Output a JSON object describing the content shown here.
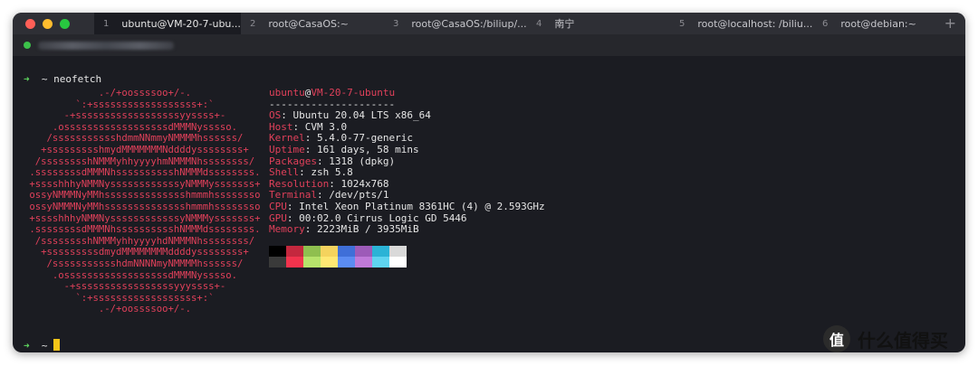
{
  "window": {
    "traffic_lights": {
      "close": "#ff5f57",
      "minimize": "#febc2e",
      "zoom": "#28c840"
    },
    "tabs": [
      {
        "num": "1",
        "title": "ubuntu@VM-20-7-ubu..."
      },
      {
        "num": "2",
        "title": "root@CasaOS:~"
      },
      {
        "num": "3",
        "title": "root@CasaOS:/biliup/..."
      },
      {
        "num": "4",
        "title": "南宁"
      },
      {
        "num": "5",
        "title": "root@localhost: /biliu..."
      },
      {
        "num": "6",
        "title": "root@debian:~"
      }
    ],
    "new_tab_label": "+",
    "host_status_color": "#3cc14a"
  },
  "terminal": {
    "prompt_arrow": "➜",
    "prompt_dir": "~",
    "command": "neofetch",
    "logo_lines": [
      "             .-/+oossssoo+/-.",
      "         `:+ssssssssssssssssss+:`",
      "       -+ssssssssssssssssssyyssss+-",
      "     .ossssssssssssssssssdMMMNysssso.",
      "    /ssssssssssshdmmNNmmyNMMMMhssssss/",
      "   +ssssssssshmydMMMMMMMNddddyssssssss+",
      "  /sssssssshNMMMyhhyyyyhmNMMMNhssssssss/",
      " .ssssssssdMMMNhsssssssssshNMMMdssssssss.",
      " +sssshhhyNMMNyssssssssssssyNMMMysssssss+",
      " ossyNMMMNyMMhsssssssssssssshmmmhssssssso",
      " ossyNMMMNyMMhsssssssssssssshmmmhssssssso",
      " +sssshhhyNMMNyssssssssssssyNMMMysssssss+",
      " .ssssssssdMMMNhsssssssssshNMMMdssssssss.",
      "  /sssssssshNMMMyhhyyyyhdNMMMNhssssssss/",
      "   +sssssssssdmydMMMMMMMMddddyssssssss+",
      "    /ssssssssssshdmNNNNmyNMMMMhssssss/",
      "     .ossssssssssssssssssdMMMNysssso.",
      "       -+sssssssssssssssssyyyssss+-",
      "         `:+ssssssssssssssssss+:`",
      "             .-/+oossssoo+/-."
    ],
    "user": "ubuntu",
    "at": "@",
    "host": "VM-20-7-ubuntu",
    "separator": "---------------------",
    "info": [
      {
        "key": "OS",
        "value": "Ubuntu 20.04 LTS x86_64"
      },
      {
        "key": "Host",
        "value": "CVM 3.0"
      },
      {
        "key": "Kernel",
        "value": "5.4.0-77-generic"
      },
      {
        "key": "Uptime",
        "value": "161 days, 58 mins"
      },
      {
        "key": "Packages",
        "value": "1318 (dpkg)"
      },
      {
        "key": "Shell",
        "value": "zsh 5.8"
      },
      {
        "key": "Resolution",
        "value": "1024x768"
      },
      {
        "key": "Terminal",
        "value": "/dev/pts/1"
      },
      {
        "key": "CPU",
        "value": "Intel Xeon Platinum 8361HC (4) @ 2.593GHz"
      },
      {
        "key": "GPU",
        "value": "00:02.0 Cirrus Logic GD 5446"
      },
      {
        "key": "Memory",
        "value": "2223MiB / 3935MiB"
      }
    ],
    "palette_top": [
      "#000000",
      "#c4283e",
      "#8fbf4f",
      "#f4d35e",
      "#3f6fd8",
      "#9d5bb8",
      "#2bb3d6",
      "#d9d9d9"
    ],
    "palette_bottom": [
      "#3a3a3a",
      "#f2334d",
      "#b6e36b",
      "#ffe873",
      "#5b8cf2",
      "#c07ad9",
      "#5fd4f0",
      "#ffffff"
    ]
  },
  "watermark": {
    "text": "什么值得买",
    "icon_glyph": "值"
  }
}
